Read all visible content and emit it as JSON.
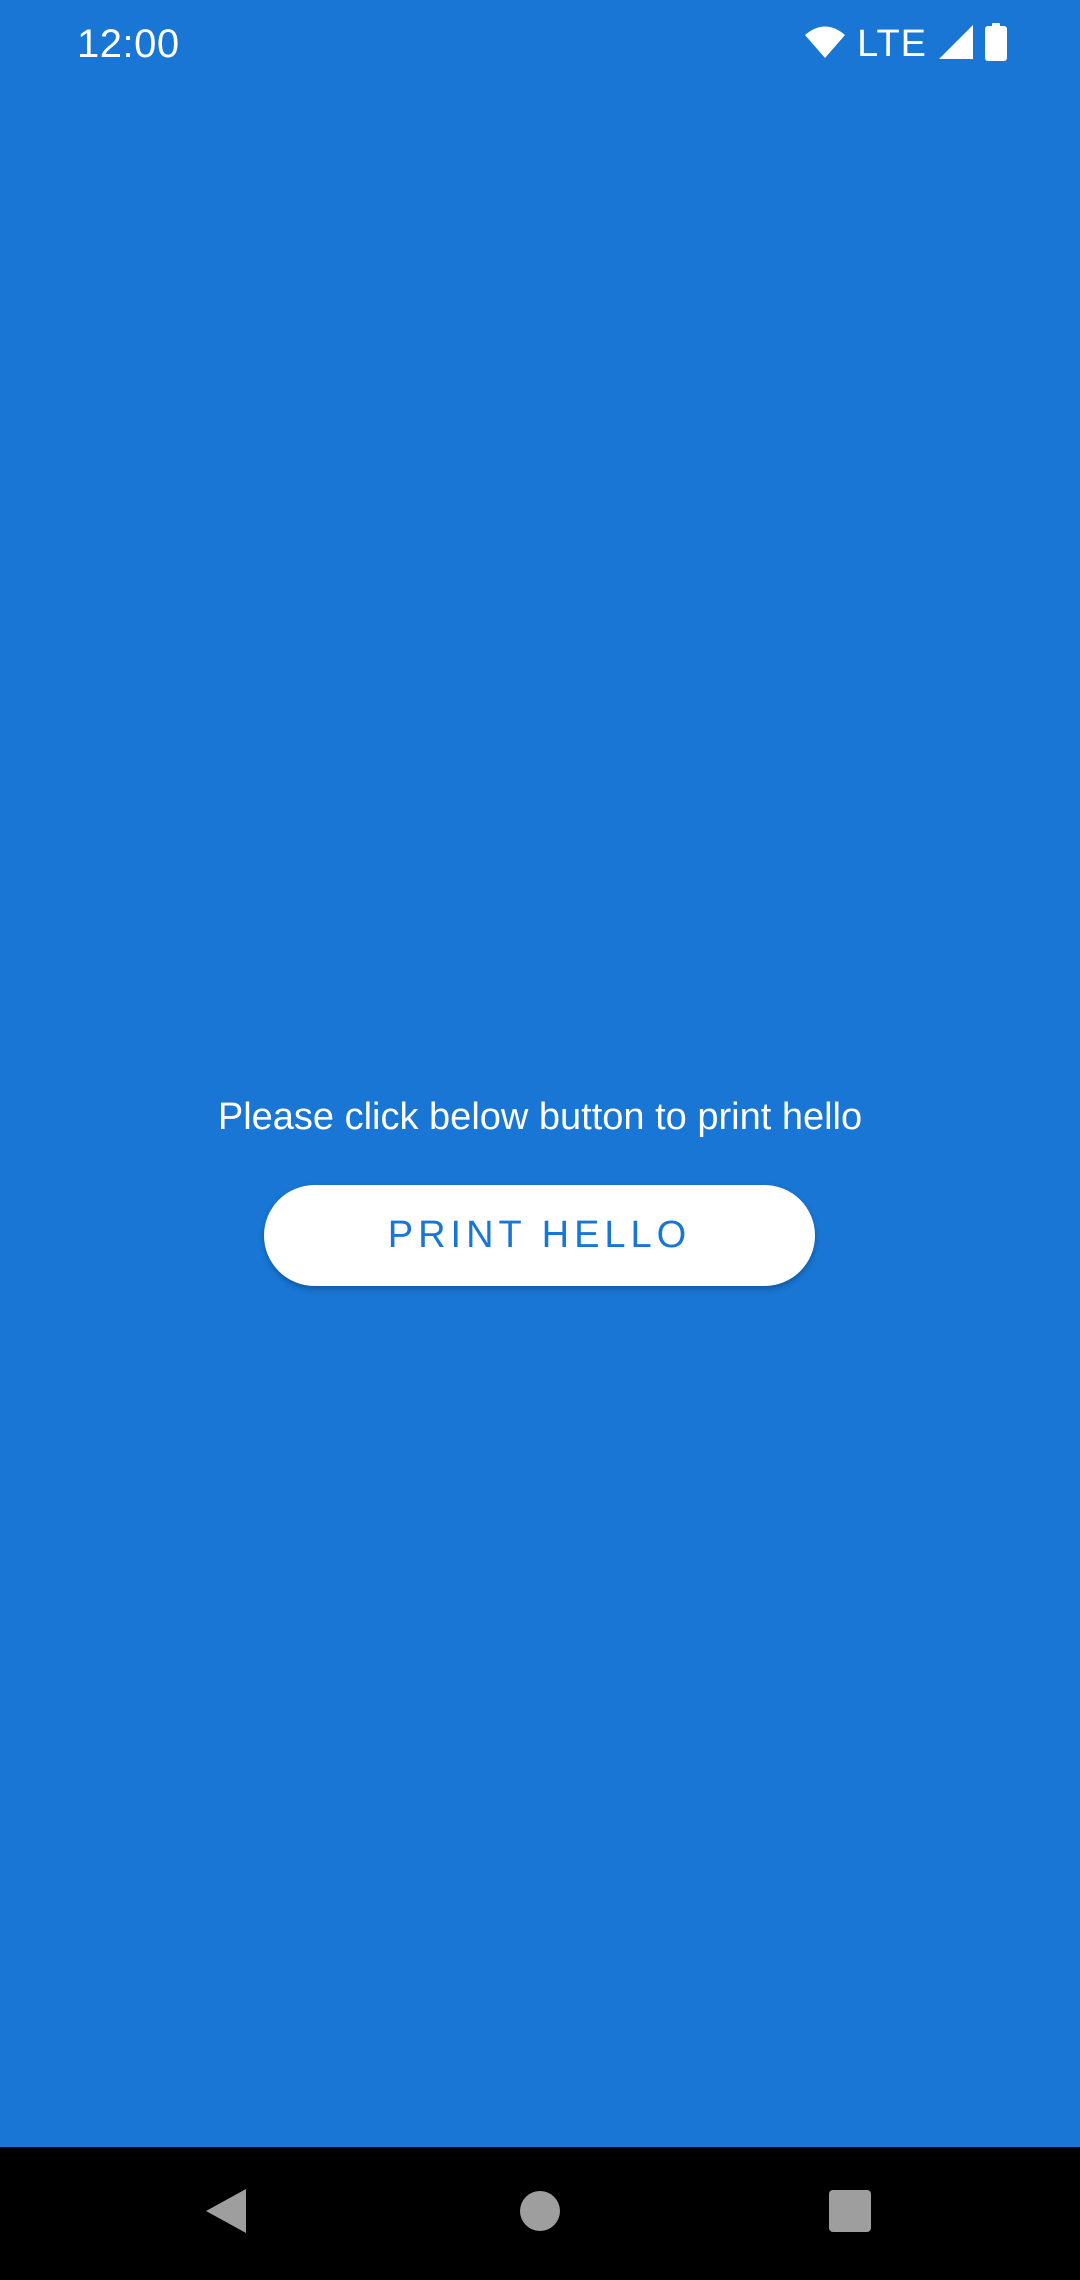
{
  "status_bar": {
    "time": "12:00",
    "network": "LTE",
    "icons": [
      "wifi-icon",
      "cell-signal-icon",
      "battery-icon"
    ]
  },
  "main": {
    "prompt": "Please click below button to print hello",
    "button_label": "PRINT HELLO"
  },
  "nav_bar": {
    "icons": [
      "back-icon",
      "home-icon",
      "recents-icon"
    ]
  },
  "colors": {
    "background": "#1976D4",
    "button_bg": "#FFFFFF",
    "button_text": "#1976D4",
    "nav_bar_bg": "#000000",
    "nav_icons": "#9E9E9E"
  }
}
